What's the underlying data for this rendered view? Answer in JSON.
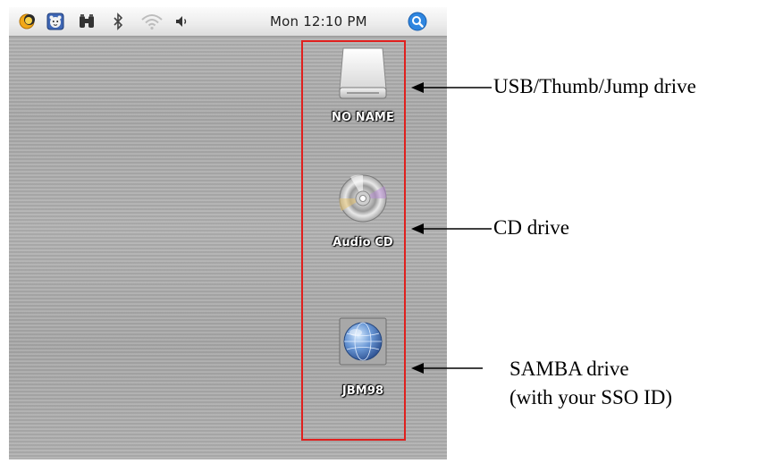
{
  "menubar": {
    "clock": "Mon 12:10 PM",
    "icons": [
      "menu-extra-yellow-icon",
      "menu-extra-face-icon",
      "binoculars-icon",
      "bluetooth-icon",
      "wifi-icon",
      "volume-icon",
      "spotlight-search-icon"
    ]
  },
  "drives": [
    {
      "label": "NO NAME",
      "icon": "usb-drive-icon"
    },
    {
      "label": "Audio CD",
      "icon": "cd-disc-icon"
    },
    {
      "label": "JBM98",
      "icon": "network-globe-icon"
    }
  ],
  "annotations": [
    {
      "lines": [
        "USB/Thumb/Jump drive"
      ]
    },
    {
      "lines": [
        "CD drive"
      ]
    },
    {
      "lines": [
        "SAMBA drive",
        "(with your SSO ID)"
      ]
    }
  ],
  "colors": {
    "highlight": "#e0201e",
    "spotlight": "#2f86e0"
  }
}
